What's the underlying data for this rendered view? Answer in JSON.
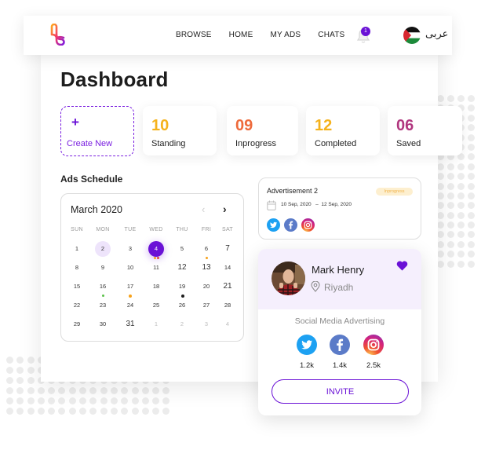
{
  "header": {
    "logo": "app-logo",
    "nav": [
      "BROWSE",
      "HOME",
      "MY ADS",
      "CHATS"
    ],
    "notifications_count": "1",
    "language_label": "عربى",
    "language_flag": "palestine-flag"
  },
  "page": {
    "title": "Dashboard"
  },
  "create_card": {
    "icon": "+",
    "label": "Create New"
  },
  "stats": [
    {
      "value": "10",
      "label": "Standing",
      "color": "#f5b21c"
    },
    {
      "value": "09",
      "label": "Inprogress",
      "color": "#ee6a3b"
    },
    {
      "value": "12",
      "label": "Completed",
      "color": "#f5b21c"
    },
    {
      "value": "06",
      "label": "Saved",
      "color": "#b1377f"
    }
  ],
  "schedule": {
    "title": "Ads Schedule",
    "calendar": {
      "month_label": "March 2020",
      "prev_icon": "‹",
      "next_icon": "›",
      "weekdays": [
        "SUN",
        "MON",
        "TUE",
        "WED",
        "THU",
        "FRI",
        "SAT"
      ],
      "weeks": [
        [
          "1",
          "2",
          "3",
          "4",
          "5",
          "6",
          "7"
        ],
        [
          "8",
          "9",
          "10",
          "11",
          "12",
          "13",
          "14"
        ],
        [
          "15",
          "16",
          "17",
          "18",
          "19",
          "20",
          "21"
        ],
        [
          "22",
          "23",
          "24",
          "25",
          "26",
          "27",
          "28"
        ],
        [
          "29",
          "30",
          "31",
          "1",
          "2",
          "3",
          "4"
        ]
      ],
      "selected_day": "4",
      "highlighted_day": "2",
      "event_colors": {
        "orange": "#f7a21b",
        "red": "#e0424b",
        "green": "#5cc14a",
        "black": "#1d1d1d"
      }
    }
  },
  "advertisement": {
    "title": "Advertisement 2",
    "status": "Inprogress",
    "start_date": "10 Sep, 2020",
    "separator": "–",
    "end_date": "12 Sep, 2020",
    "socials": [
      "twitter",
      "facebook",
      "instagram"
    ]
  },
  "profile": {
    "name": "Mark Henry",
    "location": "Riyadh",
    "favorited": true,
    "section_title": "Social Media Advertising",
    "socials": [
      {
        "network": "twitter",
        "followers": "1.2k"
      },
      {
        "network": "facebook",
        "followers": "1.4k"
      },
      {
        "network": "instagram",
        "followers": "2.5k"
      }
    ],
    "invite_label": "INVITE"
  }
}
